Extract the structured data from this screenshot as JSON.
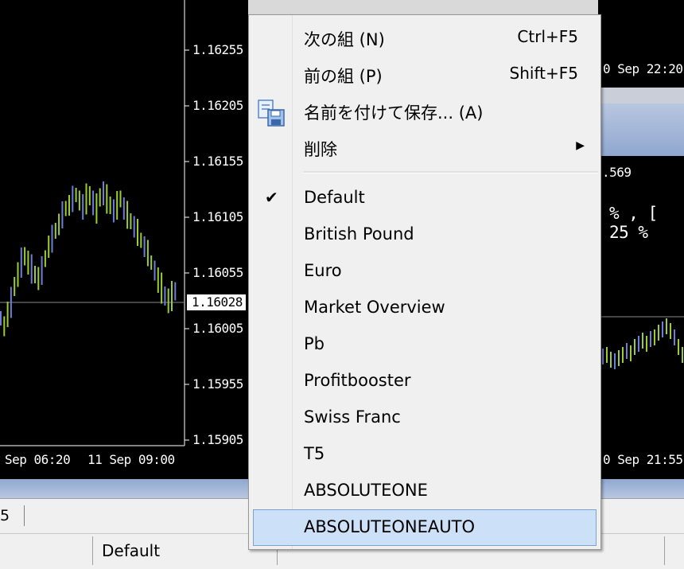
{
  "left_chart": {
    "price_axis": [
      "1.16255",
      "1.16205",
      "1.16155",
      "1.16105",
      "1.16055",
      "1.16005",
      "1.15955",
      "1.15905"
    ],
    "current_price": "1.16028",
    "time_labels": [
      "Sep 06:20",
      "11 Sep 09:00"
    ]
  },
  "right_top_chart": {
    "time_label": "0 Sep 22:20"
  },
  "right_bottom_chart": {
    "value_label": ".569",
    "info_text": "% , [ 25 %",
    "time_label": "0 Sep 21:55"
  },
  "tabbar": {
    "tab_fragment": "5"
  },
  "statusbar": {
    "profile": "Default"
  },
  "menu": {
    "items": [
      {
        "label": "次の組 (N)",
        "shortcut": "Ctrl+F5"
      },
      {
        "label": "前の組 (P)",
        "shortcut": "Shift+F5"
      },
      {
        "label": "名前を付けて保存... (A)",
        "icon": "save-as-icon"
      },
      {
        "label": "削除",
        "submenu": true
      }
    ],
    "profiles": [
      {
        "label": "Default",
        "checked": true
      },
      {
        "label": "British Pound"
      },
      {
        "label": "Euro"
      },
      {
        "label": "Market Overview"
      },
      {
        "label": "Pb"
      },
      {
        "label": "Profitbooster"
      },
      {
        "label": "Swiss Franc"
      },
      {
        "label": "T5"
      },
      {
        "label": "ABSOLUTEONE"
      },
      {
        "label": "ABSOLUTEONEAUTO",
        "highlighted": true
      }
    ]
  },
  "colors": {
    "bull_bar": "#9acd32",
    "bear_bar": "#6a7fd8",
    "highlight_bg": "#cce0f7",
    "highlight_border": "#7da2ce"
  }
}
